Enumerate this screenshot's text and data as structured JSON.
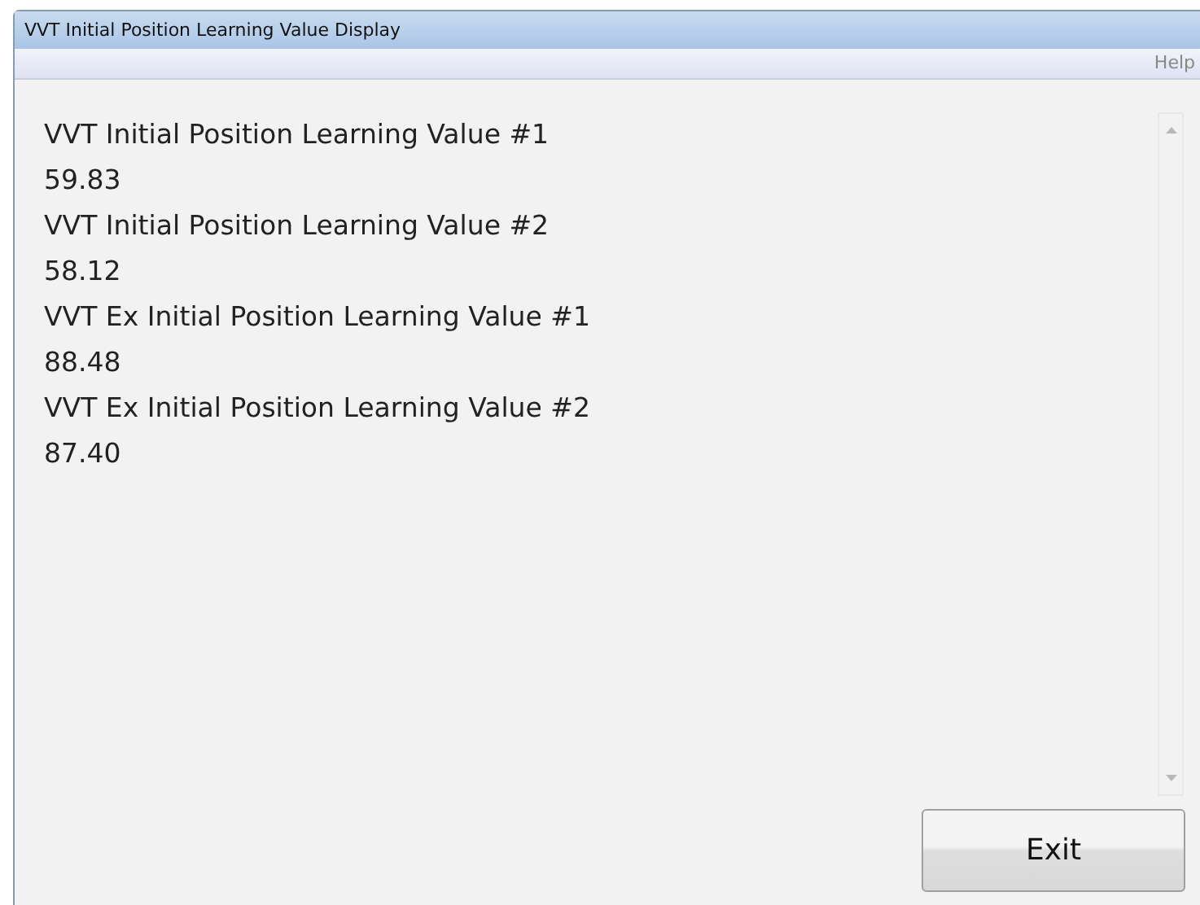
{
  "window": {
    "title": "VVT Initial Position Learning Value Display"
  },
  "menu": [
    "Help"
  ],
  "values": [
    {
      "label": "VVT Initial Position Learning Value #1",
      "value": "59.83"
    },
    {
      "label": "VVT Initial Position Learning Value #2",
      "value": "58.12"
    },
    {
      "label": "VVT Ex Initial Position Learning Value #1",
      "value": "88.48"
    },
    {
      "label": "VVT Ex Initial Position Learning Value #2",
      "value": "87.40"
    }
  ],
  "buttons": [
    "Exit"
  ]
}
